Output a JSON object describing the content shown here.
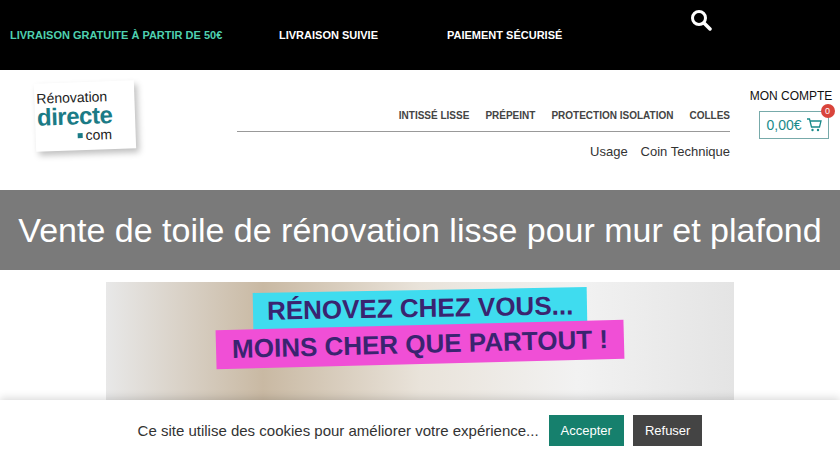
{
  "top_bar": {
    "items": [
      {
        "label": "LIVRAISON GRATUITE À PARTIR DE 50€",
        "highlighted": true
      },
      {
        "label": "LIVRAISON SUIVIE",
        "highlighted": false
      },
      {
        "label": "PAIEMENT SÉCURISÉ",
        "highlighted": false
      }
    ]
  },
  "logo": {
    "line1": "Rénovation",
    "line2": "directe",
    "line3": "com"
  },
  "nav": {
    "primary": [
      "INTISSÉ LISSE",
      "PRÉPEINT",
      "PROTECTION ISOLATION",
      "COLLES"
    ],
    "secondary": [
      "Usage",
      "Coin Technique"
    ]
  },
  "account": {
    "label": "MON COMPTE"
  },
  "cart": {
    "total": "0,00€",
    "count": "0"
  },
  "title": "Vente de toile de rénovation lisse pour mur et plafond",
  "banner": {
    "line1": "RÉNOVEZ CHEZ VOUS...",
    "line2": "MOINS CHER QUE PARTOUT !"
  },
  "cookie_bar": {
    "message": "Ce site utilise des cookies pour améliorer votre expérience...",
    "buttons": [
      {
        "label": "Accepter",
        "kind": "primary"
      },
      {
        "label": "Refuser",
        "kind": "secondary"
      }
    ]
  }
}
